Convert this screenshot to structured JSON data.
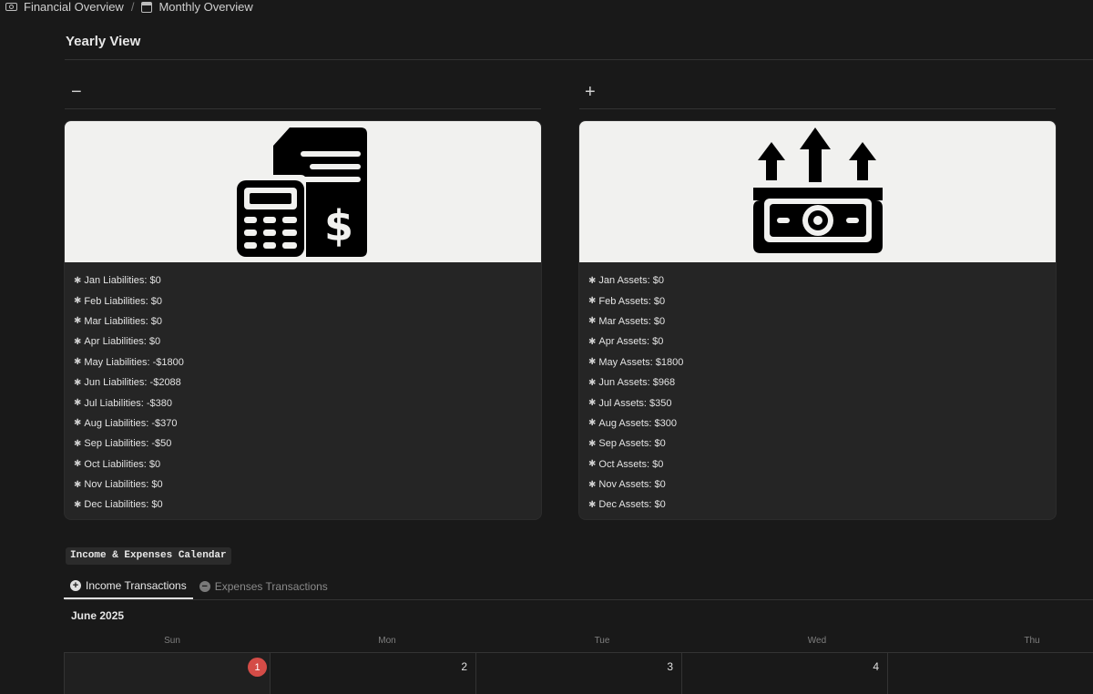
{
  "breadcrumb": {
    "items": [
      {
        "label": "Financial Overview",
        "icon": "money-icon"
      },
      {
        "label": "Monthly Overview",
        "icon": "calendar-icon"
      }
    ],
    "separator": "/"
  },
  "section_title": "Yearly View",
  "columns": [
    {
      "sign": "−",
      "cover_icon": "calculator-invoice-icon",
      "rows": [
        "Jan Liabilities: $0",
        "Feb Liabilities: $0",
        "Mar Liabilities: $0",
        "Apr Liabilities: $0",
        "May Liabilities: -$1800",
        "Jun Liabilities: -$2088",
        "Jul Liabilities: -$380",
        "Aug Liabilities: -$370",
        "Sep Liabilities: -$50",
        "Oct Liabilities: $0",
        "Nov Liabilities: $0",
        "Dec Liabilities: $0"
      ]
    },
    {
      "sign": "+",
      "cover_icon": "money-growth-icon",
      "rows": [
        "Jan Assets: $0",
        "Feb Assets: $0",
        "Mar Assets: $0",
        "Apr Assets: $0",
        "May Assets: $1800",
        "Jun Assets: $968",
        "Jul Assets: $350",
        "Aug Assets: $300",
        "Sep Assets: $0",
        "Oct Assets: $0",
        "Nov Assets: $0",
        "Dec Assets: $0"
      ]
    }
  ],
  "row_bullet": "✱",
  "calendar": {
    "code_label": "Income & Expenses Calendar",
    "tabs": [
      {
        "label": "Income Transactions",
        "icon": "plus-circle-icon",
        "active": true
      },
      {
        "label": "Expenses Transactions",
        "icon": "minus-circle-icon",
        "active": false
      }
    ],
    "month": "June 2025",
    "weekdays": [
      "Sun",
      "Mon",
      "Tue",
      "Wed",
      "Thu"
    ],
    "days": [
      "1",
      "2",
      "3",
      "4",
      ""
    ],
    "today": "1",
    "today_color": "#d44c47"
  }
}
